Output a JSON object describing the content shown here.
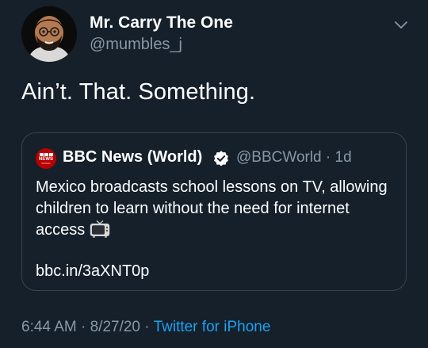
{
  "author": {
    "display_name": "Mr. Carry The One",
    "handle": "@mumbles_j",
    "avatar_icon": "memoji-avatar"
  },
  "tweet": {
    "text": "Ain’t. That. Something."
  },
  "quoted_tweet": {
    "logo_text": "NEWS",
    "logo_subtext": "WORLD",
    "display_name": "BBC News (World)",
    "verified": true,
    "handle_time": "@BBCWorld · 1d",
    "body": "Mexico broadcasts school lessons on TV, allowing children to learn without the need for internet access",
    "body_emoji": "television-emoji",
    "link": "bbc.in/3aXNT0p"
  },
  "meta": {
    "time": "6:44 AM",
    "sep1": " · ",
    "date": "8/27/20",
    "sep2": " · ",
    "source": "Twitter for iPhone"
  },
  "colors": {
    "background": "#15202b",
    "secondary_text": "#8899a6",
    "accent": "#1da1f2",
    "border": "#38444d",
    "bbc_red": "#b80000"
  }
}
